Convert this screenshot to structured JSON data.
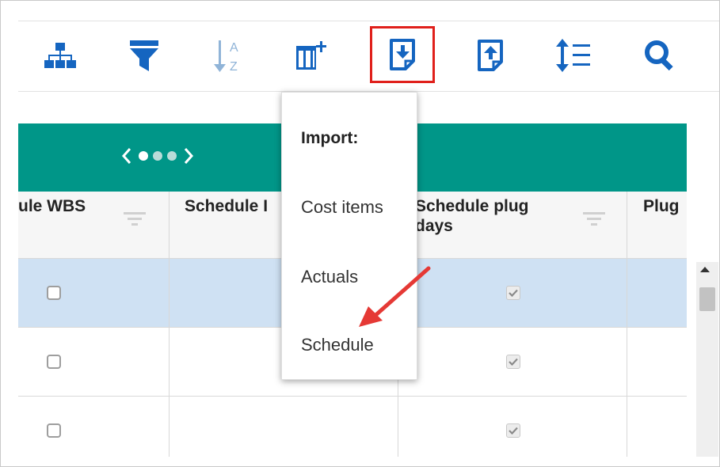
{
  "toolbar": {
    "tools": [
      {
        "icon": "hierarchy-icon"
      },
      {
        "icon": "filter-icon"
      },
      {
        "icon": "sort-az-icon",
        "letters": "A\nZ"
      },
      {
        "icon": "add-column-icon"
      },
      {
        "icon": "import-icon",
        "highlighted": true
      },
      {
        "icon": "export-icon"
      },
      {
        "icon": "row-height-icon"
      },
      {
        "icon": "search-icon"
      }
    ],
    "accent_color": "#1565c0",
    "disabled_color": "#90b4d8",
    "highlight_color": "#e0201b"
  },
  "grid": {
    "pager_color": "#009688",
    "pager_dots": 3,
    "active_dot": 0,
    "columns": [
      {
        "label": "ule WBS"
      },
      {
        "label": "Schedule I"
      },
      {
        "label_line1": "Schedule plug",
        "label_line2": "days"
      },
      {
        "label": "Plug"
      }
    ],
    "rows": [
      {
        "selected": true,
        "wbs_checked": false,
        "plug_days_checked": true
      },
      {
        "selected": false,
        "wbs_checked": false,
        "plug_days_checked": true
      },
      {
        "selected": false,
        "wbs_checked": false,
        "plug_days_checked": true
      }
    ]
  },
  "import_menu": {
    "title": "Import:",
    "items": [
      "Cost items",
      "Actuals",
      "Schedule"
    ]
  },
  "annotation_color": "#e53935"
}
